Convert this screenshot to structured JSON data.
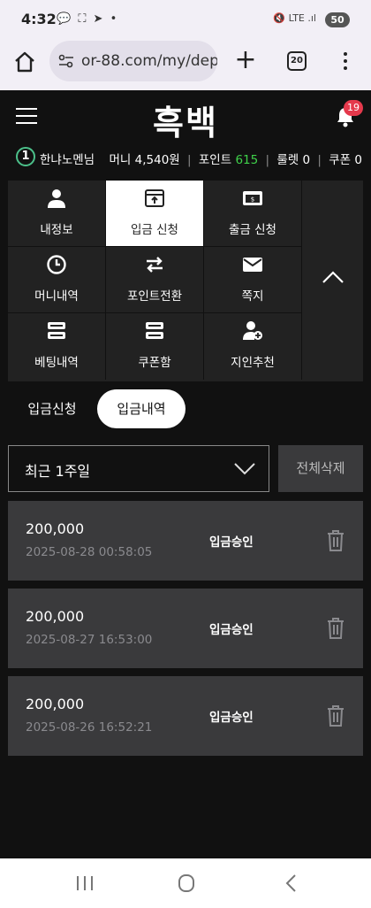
{
  "status_bar": {
    "time": "4:32",
    "notif_icons": "💬 ⛶ ➤ •",
    "right_icons": "🔇 LTE .ıl",
    "battery": "50"
  },
  "browser": {
    "url": "or-88.com/my/dep",
    "tab_count": "20"
  },
  "site": {
    "logo": "흑백",
    "notification_count": "19"
  },
  "user": {
    "level": "1",
    "name": "한냐노멘님",
    "money_label": "머니",
    "money_value": "4,540원",
    "point_label": "포인트",
    "point_value": "615",
    "roulette_label": "룰렛",
    "roulette_value": "0",
    "coupon_label": "쿠폰",
    "coupon_value": "0"
  },
  "menu": {
    "items": [
      {
        "label": "내정보",
        "icon": "user-icon"
      },
      {
        "label": "입금 신청",
        "icon": "deposit-icon"
      },
      {
        "label": "출금 신청",
        "icon": "withdraw-icon"
      },
      {
        "label": "머니내역",
        "icon": "clock-icon"
      },
      {
        "label": "포인트전환",
        "icon": "exchange-icon"
      },
      {
        "label": "쪽지",
        "icon": "mail-icon"
      },
      {
        "label": "베팅내역",
        "icon": "list-icon"
      },
      {
        "label": "쿠폰함",
        "icon": "coupon-icon"
      },
      {
        "label": "지인추천",
        "icon": "user-plus-icon"
      }
    ],
    "active_index": 1
  },
  "subtabs": {
    "deposit_request": "입금신청",
    "deposit_history": "입금내역"
  },
  "filter": {
    "period": "최근 1주일",
    "delete_all": "전체삭제"
  },
  "deposits": [
    {
      "amount": "200,000",
      "date": "2025-08-28 00:58:05",
      "status": "입금승인"
    },
    {
      "amount": "200,000",
      "date": "2025-08-27 16:53:00",
      "status": "입금승인"
    },
    {
      "amount": "200,000",
      "date": "2025-08-26 16:52:21",
      "status": "입금승인"
    }
  ],
  "colors": {
    "background": "#111111",
    "panel": "#222222",
    "row": "#3a3a3c",
    "point_green": "#3fd14a",
    "badge_red": "#e5394c"
  }
}
